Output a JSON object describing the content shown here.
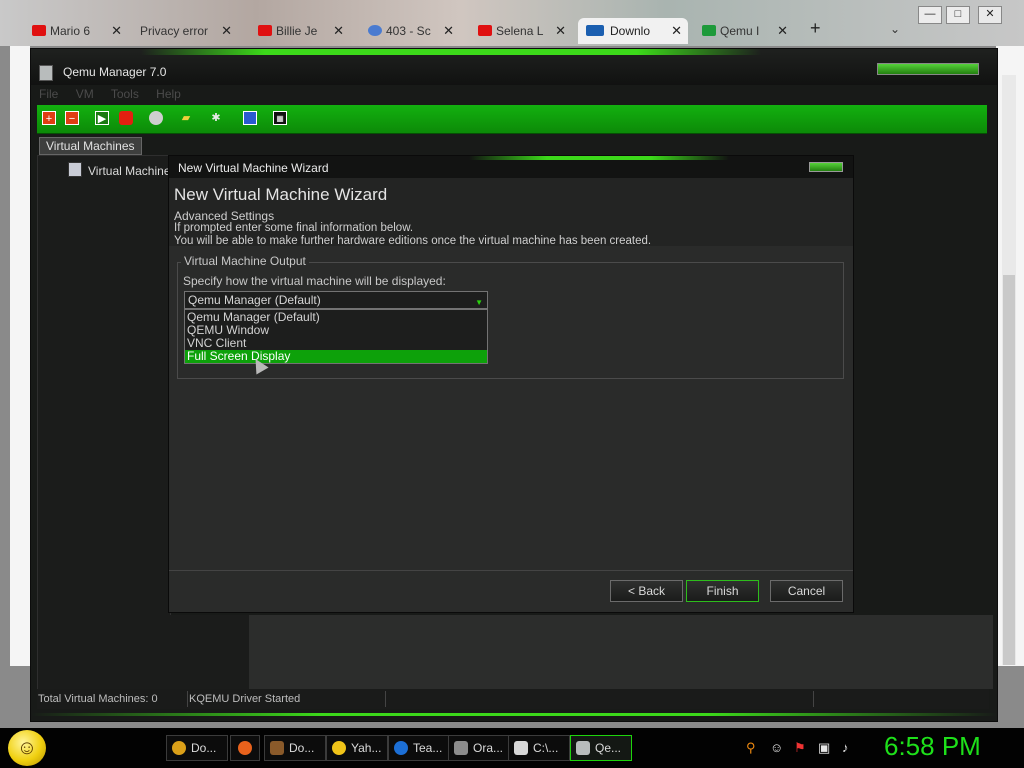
{
  "browser": {
    "tabs": [
      {
        "label": "Mario 6",
        "favicon_color": "#e01010"
      },
      {
        "label": "Privacy error",
        "favicon_color": ""
      },
      {
        "label": "Billie Je",
        "favicon_color": "#e01010"
      },
      {
        "label": "403 - Sc",
        "favicon_color": "#4a7bd0"
      },
      {
        "label": "Selena L",
        "favicon_color": "#e01010"
      },
      {
        "label": "Downlo",
        "favicon_color": "#1b5fb0"
      },
      {
        "label": "Qemu I",
        "favicon_color": "#1d9a3a"
      }
    ],
    "new_tab": "+",
    "tab_menu": "⌄",
    "window_controls": {
      "minimize": "—",
      "maximize": "□",
      "close": "✕"
    }
  },
  "app": {
    "title": "Qemu Manager 7.0",
    "menu": [
      "File",
      "VM",
      "Tools",
      "Help"
    ],
    "left_tab": "Virtual Machines",
    "tree_item": "Virtual Machines",
    "status": {
      "total": "Total Virtual Machines: 0",
      "driver": "KQEMU Driver Started"
    }
  },
  "wizard": {
    "titlebar": "New Virtual Machine Wizard",
    "heading": "New Virtual Machine Wizard",
    "subheading": "Advanced Settings",
    "info1": "If prompted enter some final information below.",
    "info2": "You will be able to make further hardware editions once the virtual machine has been created.",
    "group_label": "Virtual Machine Output",
    "field_label": "Specify how the virtual machine will be displayed:",
    "selected_value": "Qemu Manager (Default)",
    "options": [
      {
        "label": "Qemu Manager (Default)",
        "highlighted": false
      },
      {
        "label": "QEMU Window",
        "highlighted": false
      },
      {
        "label": "VNC Client",
        "highlighted": false
      },
      {
        "label": "Full Screen Display",
        "highlighted": true
      }
    ],
    "buttons": {
      "back": "< Back",
      "finish": "Finish",
      "cancel": "Cancel"
    }
  },
  "taskbar": {
    "items": [
      {
        "label": "Do...",
        "icon": "chrome-icon",
        "color": "#dba019"
      },
      {
        "label": "",
        "icon": "firefox-icon",
        "color": "#e8621c"
      },
      {
        "label": "Do...",
        "icon": "document-icon",
        "color": "#8a5a2a"
      },
      {
        "label": "Yah...",
        "icon": "yahoo-smiley-icon",
        "color": "#f0c419"
      },
      {
        "label": "Tea...",
        "icon": "teamviewer-icon",
        "color": "#1c6fd6"
      },
      {
        "label": "Ora...",
        "icon": "virtualbox-icon",
        "color": "#8c8c8c"
      },
      {
        "label": "C:\\...",
        "icon": "7zip-icon",
        "color": "#d8d8d8"
      },
      {
        "label": "Qe...",
        "icon": "qemu-icon",
        "color": "#b8bcbc"
      }
    ],
    "clock": "6:58 PM"
  },
  "colors": {
    "accent_green": "#0da10a",
    "clock_green": "#1ee01a"
  }
}
